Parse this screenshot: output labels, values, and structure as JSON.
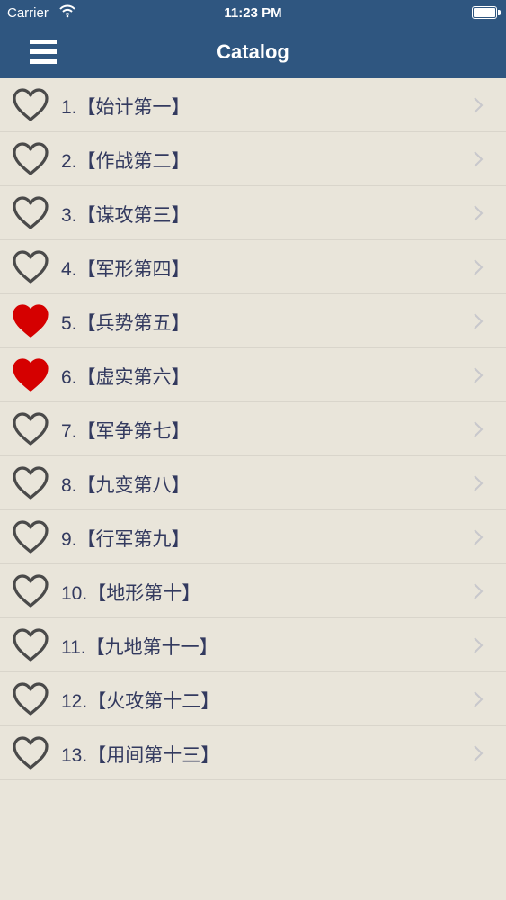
{
  "status_bar": {
    "carrier": "Carrier",
    "time": "11:23 PM"
  },
  "navbar": {
    "title": "Catalog",
    "menu_icon": "menu-icon"
  },
  "colors": {
    "bar": "#2f5680",
    "heart_filled": "#d50000",
    "heart_outline": "#4a4a4a",
    "label_text": "#333a5f"
  },
  "items": [
    {
      "label": "1.【始计第一】",
      "favorite": false
    },
    {
      "label": "2.【作战第二】",
      "favorite": false
    },
    {
      "label": "3.【谋攻第三】",
      "favorite": false
    },
    {
      "label": "4.【军形第四】",
      "favorite": false
    },
    {
      "label": "5.【兵势第五】",
      "favorite": true
    },
    {
      "label": "6.【虚实第六】",
      "favorite": true
    },
    {
      "label": "7.【军争第七】",
      "favorite": false
    },
    {
      "label": "8.【九变第八】",
      "favorite": false
    },
    {
      "label": "9.【行军第九】",
      "favorite": false
    },
    {
      "label": "10.【地形第十】",
      "favorite": false
    },
    {
      "label": "11.【九地第十一】",
      "favorite": false
    },
    {
      "label": "12.【火攻第十二】",
      "favorite": false
    },
    {
      "label": "13.【用间第十三】",
      "favorite": false
    }
  ]
}
